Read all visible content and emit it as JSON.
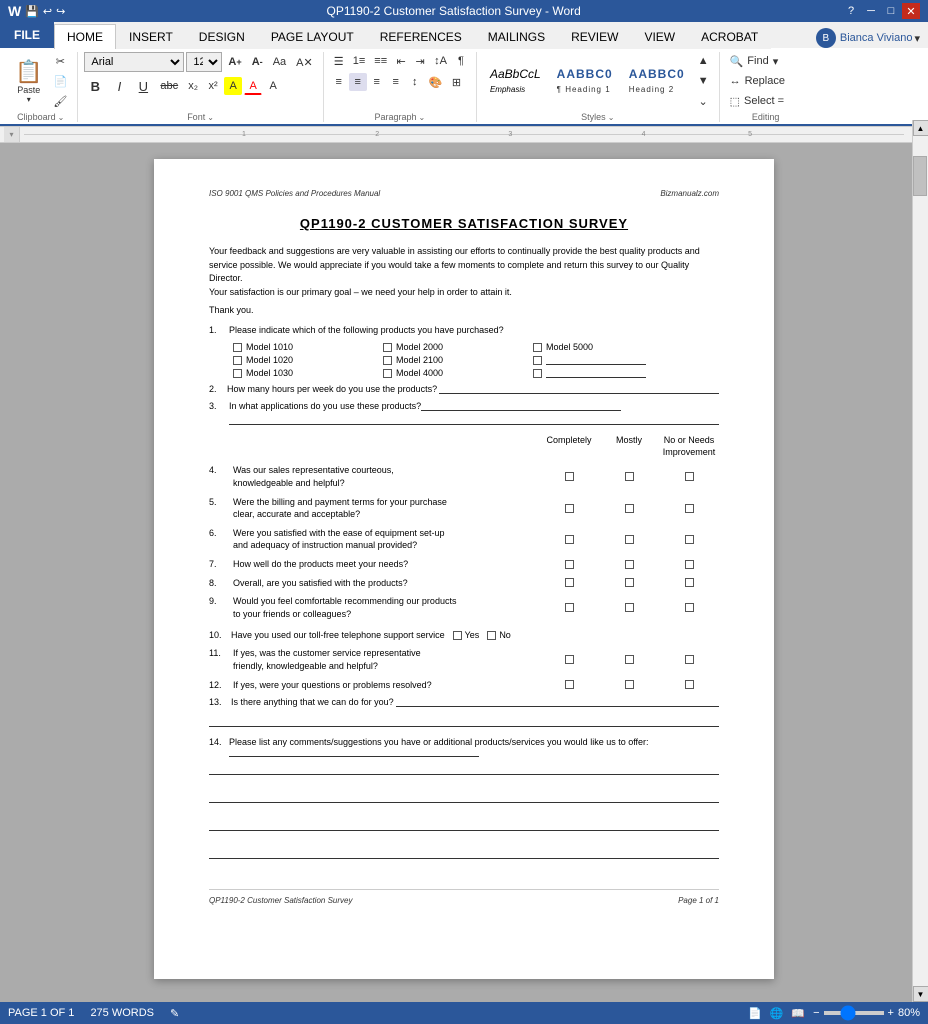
{
  "titleBar": {
    "title": "QP1190-2 Customer Satisfaction Survey - Word",
    "helpIcon": "?",
    "minimizeIcon": "─",
    "maximizeIcon": "□",
    "closeIcon": "✕",
    "appIcon": "W"
  },
  "ribbon": {
    "tabs": [
      "FILE",
      "HOME",
      "INSERT",
      "DESIGN",
      "PAGE LAYOUT",
      "REFERENCES",
      "MAILINGS",
      "REVIEW",
      "VIEW",
      "ACROBAT"
    ],
    "activeTab": "HOME",
    "user": "Bianca Viviano",
    "fontName": "Arial",
    "fontSize": "12",
    "groups": {
      "clipboard": "Clipboard",
      "font": "Font",
      "paragraph": "Paragraph",
      "styles": "Styles",
      "editing": "Editing"
    },
    "buttons": {
      "paste": "Paste",
      "find": "Find",
      "replace": "Replace",
      "select": "Select ="
    },
    "styles": [
      {
        "label": "AaBbCcL",
        "name": "Emphasis"
      },
      {
        "label": "AABBC0",
        "name": "¶ Heading 1"
      },
      {
        "label": "AABBC0",
        "name": "Heading 2"
      }
    ]
  },
  "document": {
    "header": {
      "left": "ISO 9001 QMS Policies and Procedures Manual",
      "right": "Bizmanualz.com"
    },
    "title": "QP1190-2 CUSTOMER SATISFACTION SURVEY",
    "intro": [
      "Your feedback and suggestions are very valuable in assisting our efforts to continually provide the best",
      "quality products and service possible.  We would appreciate if you would take a few moments to",
      "complete and return this survey to our Quality Director.",
      "Your satisfaction is our primary goal – we need your help in order to attain it."
    ],
    "thankYou": "Thank you.",
    "questions": [
      {
        "num": "1.",
        "text": "Please indicate which of the following products you have purchased?",
        "type": "checkbox-grid",
        "items": [
          [
            "Model 1010",
            "Model 2000",
            "Model 5000"
          ],
          [
            "Model 1020",
            "Model 2100",
            ""
          ],
          [
            "Model 1030",
            "Model 4000",
            ""
          ]
        ]
      },
      {
        "num": "2.",
        "text": "How many hours per week do you use the products?",
        "type": "fill-line"
      },
      {
        "num": "3.",
        "text": "In what applications do you use these products?",
        "type": "fill-line-multi"
      }
    ],
    "ratingTable": {
      "headers": [
        "Completely",
        "Mostly",
        "No or Needs Improvement"
      ],
      "questions": [
        {
          "num": "4.",
          "text": "Was our sales representative courteous, knowledgeable and helpful?"
        },
        {
          "num": "5.",
          "text": "Were the billing and payment terms for your purchase clear, accurate and acceptable?"
        },
        {
          "num": "6.",
          "text": "Were you satisfied with the ease of equipment set-up and adequacy of instruction manual provided?"
        },
        {
          "num": "7.",
          "text": "How well do the products meet your needs?"
        },
        {
          "num": "8.",
          "text": "Overall, are you satisfied with the products?"
        },
        {
          "num": "9.",
          "text": "Would you feel comfortable recommending our products to your friends or colleagues?"
        }
      ]
    },
    "phoneSupportQ": {
      "num": "10.",
      "text": "Have you used our toll-free telephone support service",
      "yesLabel": "Yes",
      "noLabel": "No"
    },
    "postPhoneQs": [
      {
        "num": "11.",
        "text": "If yes, was the customer service representative friendly, knowledgeable and helpful?"
      },
      {
        "num": "12.",
        "text": "If yes, were your questions or problems resolved?"
      },
      {
        "num": "13.",
        "text": "Is there anything that we can do for you?"
      }
    ],
    "commentsQ": {
      "num": "14.",
      "text": "Please list any comments/suggestions you have or additional products/services you would like us to offer:"
    },
    "footer": {
      "left": "QP1190-2 Customer Satisfaction Survey",
      "right": "Page 1 of 1"
    }
  },
  "statusBar": {
    "pageInfo": "PAGE 1 OF 1",
    "wordCount": "275 WORDS",
    "editIcon": "✎",
    "zoom": "80%"
  }
}
